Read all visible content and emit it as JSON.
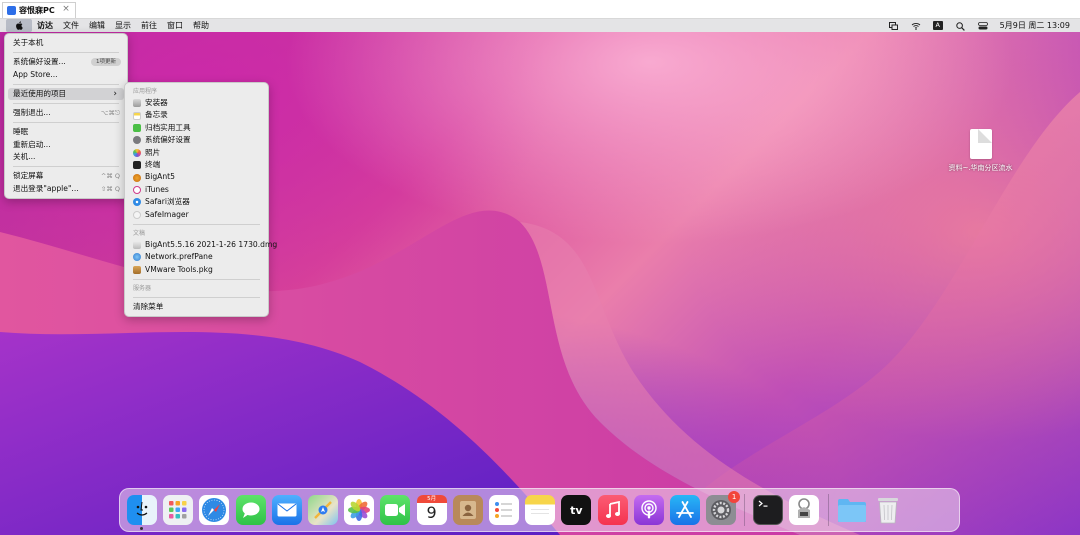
{
  "window_tab": {
    "title": "容恨寐PC",
    "close": "×"
  },
  "menubar": {
    "apple": "",
    "items": [
      "访达",
      "文件",
      "编辑",
      "显示",
      "前往",
      "窗口",
      "帮助"
    ],
    "datetime": "5月9日 周二 13:09",
    "input_method": "A"
  },
  "apple_menu": {
    "about": "关于本机",
    "prefs": "系统偏好设置...",
    "prefs_badge": "1项更新",
    "appstore": "App Store...",
    "recent": "最近使用的项目",
    "force_quit": "强制退出...",
    "force_quit_shortcut": "⌥⌘⎋",
    "sleep": "睡眠",
    "restart": "重新启动...",
    "shutdown": "关机...",
    "lock": "锁定屏幕",
    "lock_shortcut": "^⌘ Q",
    "logout": "退出登录\"apple\"...",
    "logout_shortcut": "⇧⌘ Q"
  },
  "recent_menu": {
    "apps_header": "应用程序",
    "apps": [
      "安装器",
      "备忘录",
      "归档实用工具",
      "系统偏好设置",
      "照片",
      "终端",
      "BigAnt5",
      "iTunes",
      "Safari浏览器",
      "SafeImager"
    ],
    "docs_header": "文稿",
    "docs": [
      "BigAnt5.5.16 2021-1-26 1730.dmg",
      "Network.prefPane",
      "VMware Tools.pkg"
    ],
    "servers_header": "服务器",
    "clear": "清除菜单"
  },
  "desktop": {
    "file_label": "资料~.华南分区流水"
  },
  "dock": {
    "calendar_month": "5月",
    "calendar_day": "9",
    "tv_label": "tv",
    "settings_badge": "1",
    "apps": [
      "finder",
      "launchpad",
      "safari",
      "messages",
      "mail",
      "maps",
      "photos",
      "facetime",
      "calendar",
      "contacts",
      "reminders",
      "notes",
      "tv",
      "music",
      "podcasts",
      "app-store",
      "system-preferences",
      "terminal",
      "automator",
      "downloads-folder",
      "trash"
    ]
  },
  "colors": {
    "accent": "#2d6ee8",
    "menu_bg": "#ececec",
    "menubar_bg": "#e4e4e6",
    "badge_red": "#f2443c"
  }
}
